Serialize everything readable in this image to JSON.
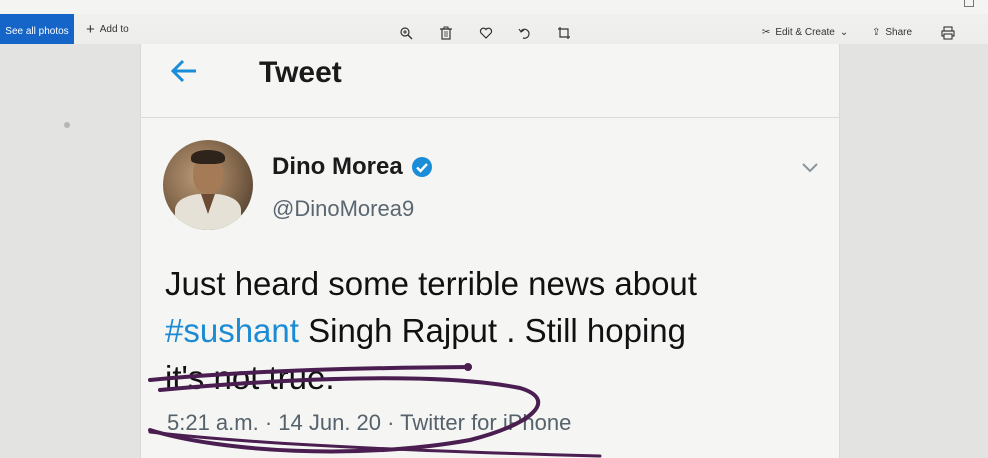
{
  "toolbar": {
    "see_all_label": "See all photos",
    "add_to_label": "Add to",
    "edit_create_label": "Edit & Create",
    "share_label": "Share",
    "icons": [
      "zoom-icon",
      "delete-icon",
      "favorite-icon",
      "rotate-icon",
      "crop-icon",
      "print-icon"
    ]
  },
  "tweet_page": {
    "title": "Tweet",
    "author": {
      "name": "Dino Morea",
      "handle": "@DinoMorea9",
      "verified": true
    },
    "text_parts": {
      "line1": "Just heard some terrible news about",
      "hashtag": "#sushant",
      "line2_rest": " Singh Rajput . Still hoping",
      "line3": "it's not true."
    },
    "meta": "5:21 a.m. · 14 Jun. 20 · Twitter for iPhone"
  },
  "colors": {
    "accent_blue": "#1a8cd8",
    "toolbar_button": "#1565c8",
    "ink_scribble": "#4a1e50"
  }
}
